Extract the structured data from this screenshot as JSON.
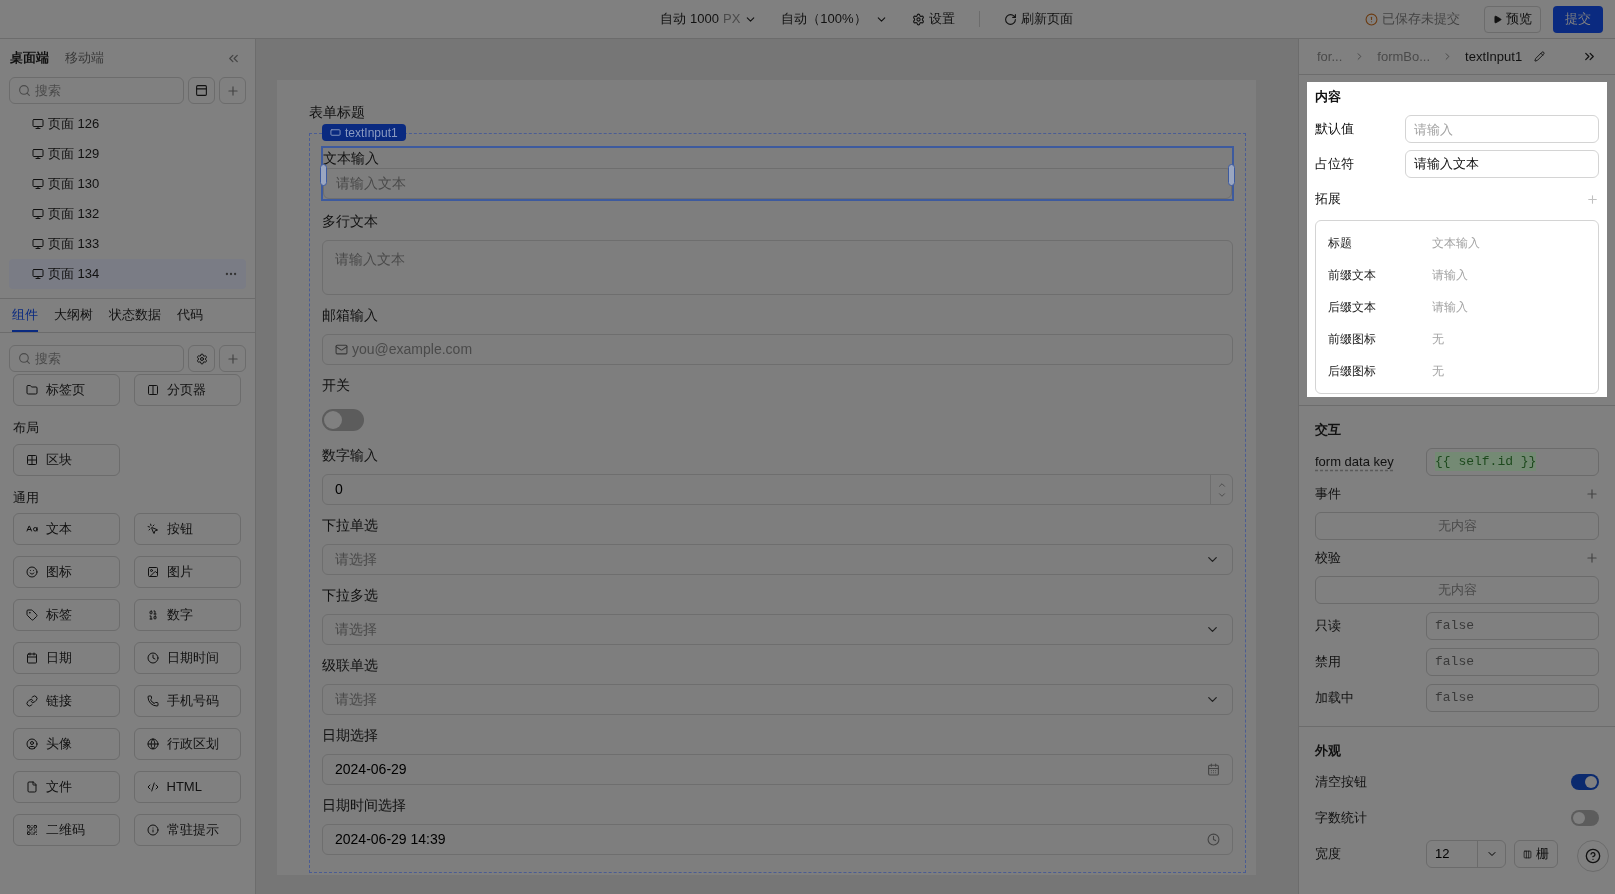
{
  "toolbar": {
    "canvas_width": "自动 1000",
    "unit": "PX",
    "zoom": "自动（100%）",
    "settings": "设置",
    "refresh": "刷新页面",
    "status": "已保存未提交",
    "preview": "预览",
    "submit": "提交"
  },
  "sidebar": {
    "platform_tabs": [
      {
        "label": "桌面端",
        "selected": true
      },
      {
        "label": "移动端",
        "selected": false
      }
    ],
    "search": {
      "placeholder": "搜索"
    },
    "pages": [
      {
        "label": "页面 126",
        "selected": false
      },
      {
        "label": "页面 129",
        "selected": false
      },
      {
        "label": "页面 130",
        "selected": false
      },
      {
        "label": "页面 132",
        "selected": false
      },
      {
        "label": "页面 133",
        "selected": false
      },
      {
        "label": "页面 134",
        "selected": true
      }
    ],
    "panel_tabs": [
      {
        "label": "组件",
        "selected": true
      },
      {
        "label": "大纲树",
        "selected": false
      },
      {
        "label": "状态数据",
        "selected": false
      },
      {
        "label": "代码",
        "selected": false
      }
    ],
    "component_search": {
      "placeholder": "搜索"
    },
    "component_groups": [
      {
        "items": [
          "标签页",
          "分页器"
        ]
      },
      {
        "title": "布局",
        "items": [
          "区块"
        ]
      },
      {
        "title": "通用",
        "items": [
          "文本",
          "按钮",
          "图标",
          "图片",
          "标签",
          "数字",
          "日期",
          "日期时间",
          "链接",
          "手机号码",
          "头像",
          "行政区划",
          "文件",
          "HTML",
          "二维码",
          "常驻提示"
        ]
      }
    ]
  },
  "canvas": {
    "form_title": "表单标题",
    "selection_tag": "textInput1",
    "fields": [
      {
        "kind": "text",
        "label": "文本输入",
        "placeholder": "请输入文本",
        "selected": true
      },
      {
        "kind": "textarea",
        "label": "多行文本",
        "placeholder": "请输入文本",
        "selected": false
      },
      {
        "kind": "email",
        "label": "邮箱输入",
        "placeholder": "you@example.com",
        "selected": false
      },
      {
        "kind": "switch",
        "label": "开关",
        "on": false,
        "selected": false
      },
      {
        "kind": "number",
        "label": "数字输入",
        "value": "0",
        "selected": false
      },
      {
        "kind": "select",
        "label": "下拉单选",
        "placeholder": "请选择",
        "selected": false
      },
      {
        "kind": "select",
        "label": "下拉多选",
        "placeholder": "请选择",
        "selected": false
      },
      {
        "kind": "select",
        "label": "级联单选",
        "placeholder": "请选择",
        "selected": false
      },
      {
        "kind": "date",
        "label": "日期选择",
        "value": "2024-06-29",
        "selected": false
      },
      {
        "kind": "datetime",
        "label": "日期时间选择",
        "value": "2024-06-29 14:39",
        "selected": false
      }
    ]
  },
  "inspector": {
    "breadcrumb": [
      "for...",
      "formBo...",
      "textInput1"
    ],
    "content": {
      "title": "内容",
      "default_value": {
        "label": "默认值",
        "placeholder": "请输入"
      },
      "placeholder_field": {
        "label": "占位符",
        "value": "请输入文本"
      },
      "extension_title": "拓展",
      "extension_rows": [
        {
          "label": "标题",
          "value": "文本输入"
        },
        {
          "label": "前缀文本",
          "value": "请输入"
        },
        {
          "label": "后缀文本",
          "value": "请输入"
        },
        {
          "label": "前缀图标",
          "value": "无"
        },
        {
          "label": "后缀图标",
          "value": "无"
        }
      ]
    },
    "interaction": {
      "title": "交互",
      "form_data_key": {
        "label": "form data key",
        "value": "{{ self.id }}"
      },
      "events": {
        "label": "事件",
        "empty": "无内容"
      },
      "validation": {
        "label": "校验",
        "empty": "无内容"
      },
      "flags": [
        {
          "label": "只读",
          "placeholder": "false"
        },
        {
          "label": "禁用",
          "placeholder": "false"
        },
        {
          "label": "加载中",
          "placeholder": "false"
        }
      ]
    },
    "appearance": {
      "title": "外观",
      "toggles": [
        {
          "label": "清空按钮",
          "on": true
        },
        {
          "label": "字数统计",
          "on": false
        }
      ],
      "width": {
        "label": "宽度",
        "value": "12",
        "grid_button": "栅"
      }
    }
  }
}
